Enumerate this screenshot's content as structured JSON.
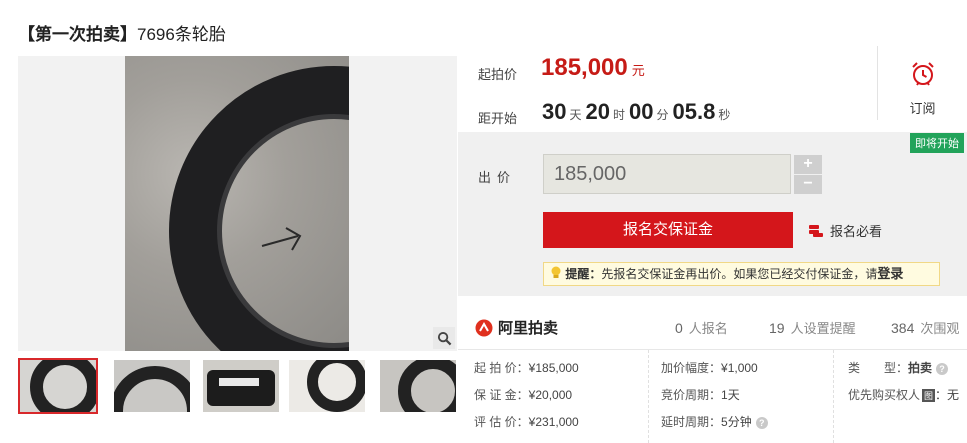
{
  "title": {
    "bracket_part": "【第一次拍卖】",
    "rest": "7696条轮胎"
  },
  "price": {
    "start_label": "起拍价",
    "start_value": "185,000",
    "currency": "元",
    "countdown_label": "距开始",
    "days": "30",
    "days_unit": "天",
    "hours": "20",
    "hours_unit": "时",
    "minutes": "00",
    "minutes_unit": "分",
    "seconds": "05.8",
    "seconds_unit": "秒"
  },
  "subscribe": {
    "label": "订阅",
    "icon": "alarm-clock-icon"
  },
  "bid": {
    "badge": "即将开始",
    "label": "出价",
    "input_value": "185,000",
    "plus": "+",
    "minus": "−",
    "deposit_button": "报名交保证金",
    "notice_link": "报名必看",
    "tip_prefix": "提醒：",
    "tip_text": "先报名交保证金再出价。如果您已经交付保证金，请",
    "tip_login": "登录"
  },
  "stats": {
    "brand": "阿里拍卖",
    "signups": "0",
    "signups_label": "人报名",
    "reminders": "19",
    "reminders_label": "人设置提醒",
    "views": "384",
    "views_label": "次围观"
  },
  "info": {
    "start_price_k": "起 拍 价：",
    "start_price_v": "¥185,000",
    "deposit_k": "保 证 金：",
    "deposit_v": "¥20,000",
    "appraisal_k": "评 估 价：",
    "appraisal_v": "¥231,000",
    "increment_k": "加价幅度：",
    "increment_v": "¥1,000",
    "bid_cycle_k": "竞价周期：",
    "bid_cycle_v": "1天",
    "delay_k": "延时周期：",
    "delay_v": "5分钟",
    "type_k": "类　　型：",
    "type_v": "拍卖",
    "priority_k": "优先购买权人",
    "priority_badge": "图",
    "priority_v": "：无"
  },
  "colors": {
    "price_red": "#c61b16",
    "button_red": "#d4161b",
    "badge_green": "#22a35a",
    "brand_red": "#e0301e"
  }
}
